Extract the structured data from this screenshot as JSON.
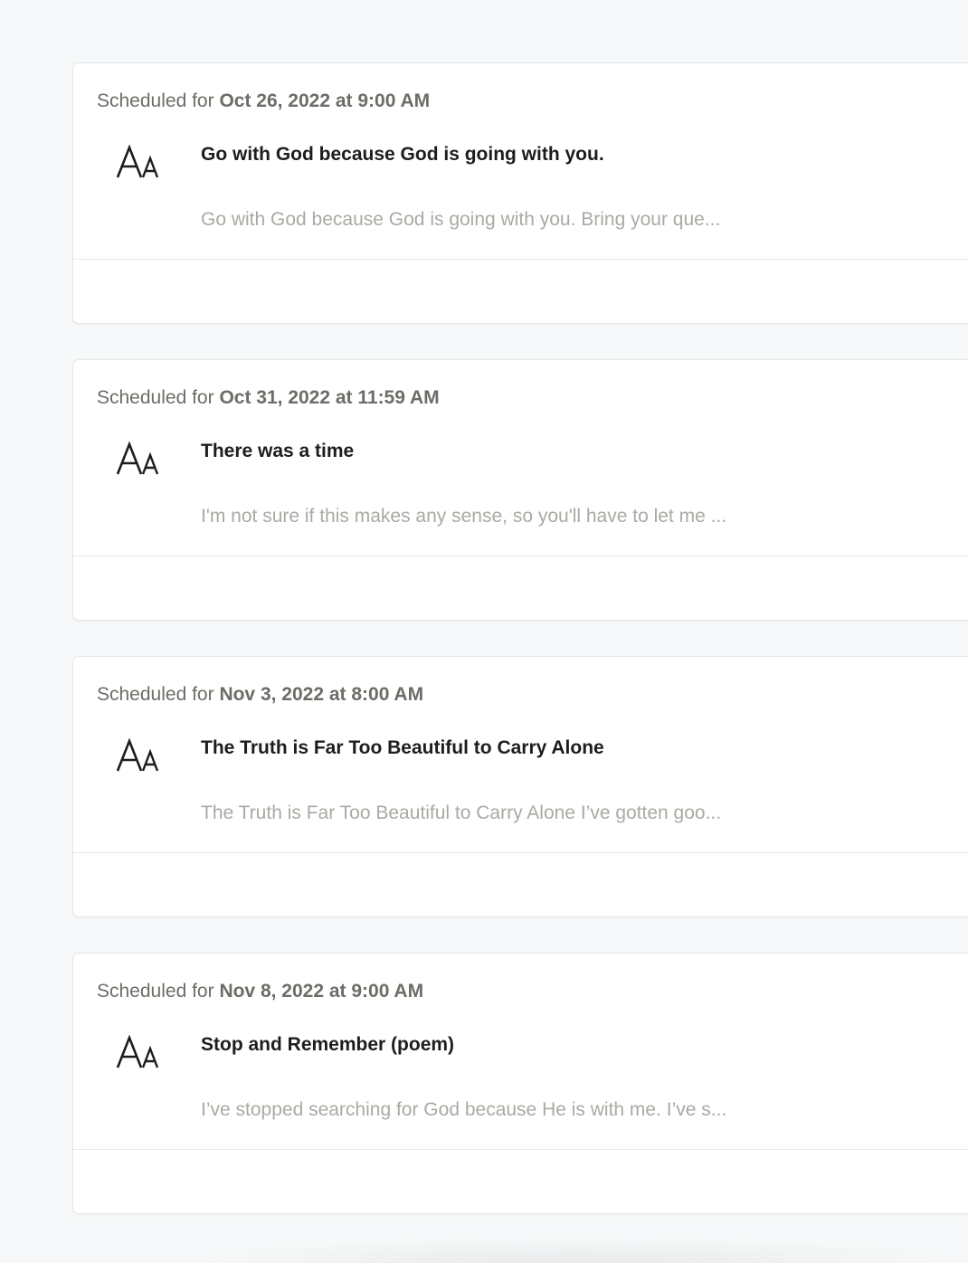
{
  "posts": [
    {
      "scheduled_prefix": "Scheduled for",
      "scheduled_date": "Oct 26, 2022 at 9:00 AM",
      "title": "Go with God because God is going with you.",
      "excerpt": "Go with God because God is going with you. Bring your que...",
      "icon": "text-type-icon"
    },
    {
      "scheduled_prefix": "Scheduled for",
      "scheduled_date": "Oct 31, 2022 at 11:59 AM",
      "title": "There was a time",
      "excerpt": "I'm not sure if this makes any sense, so you'll have to let me ...",
      "icon": "text-type-icon"
    },
    {
      "scheduled_prefix": "Scheduled for",
      "scheduled_date": "Nov 3, 2022 at 8:00 AM",
      "title": "The Truth is Far Too Beautiful to Carry Alone",
      "excerpt": "The Truth is Far Too Beautiful to Carry Alone I’ve gotten goo...",
      "icon": "text-type-icon"
    },
    {
      "scheduled_prefix": "Scheduled for",
      "scheduled_date": "Nov 8, 2022 at 9:00 AM",
      "title": "Stop and Remember (poem)",
      "excerpt": "I’ve stopped searching for God because He is with me. I’ve s...",
      "icon": "text-type-icon"
    }
  ]
}
